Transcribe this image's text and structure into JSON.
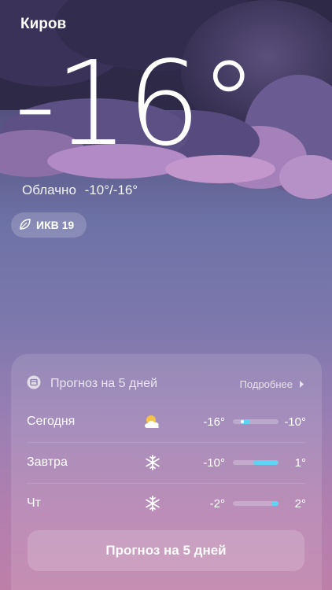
{
  "location": {
    "city": "Киров"
  },
  "current": {
    "temperature": "-16°",
    "condition": "Облачно",
    "range": "-10°/-16°"
  },
  "aqi": {
    "label": "ИКВ 19",
    "icon": "leaf-icon"
  },
  "forecast": {
    "title": "Прогноз на 5 дней",
    "more_label": "Подробнее",
    "rows": [
      {
        "day": "Сегодня",
        "icon": "partly-cloudy-icon",
        "low": "-16°",
        "high": "-10°",
        "bar_start": 0.18,
        "bar_end": 0.38,
        "current": 0.2
      },
      {
        "day": "Завтра",
        "icon": "snowflake-icon",
        "low": "-10°",
        "high": "1°",
        "bar_start": 0.45,
        "bar_end": 0.98
      },
      {
        "day": "Чт",
        "icon": "snowflake-icon",
        "low": "-2°",
        "high": "2°",
        "bar_start": 0.85,
        "bar_end": 1.0
      }
    ],
    "button_label": "Прогноз на 5 дней"
  },
  "colors": {
    "accent": "#5fd3f3"
  }
}
